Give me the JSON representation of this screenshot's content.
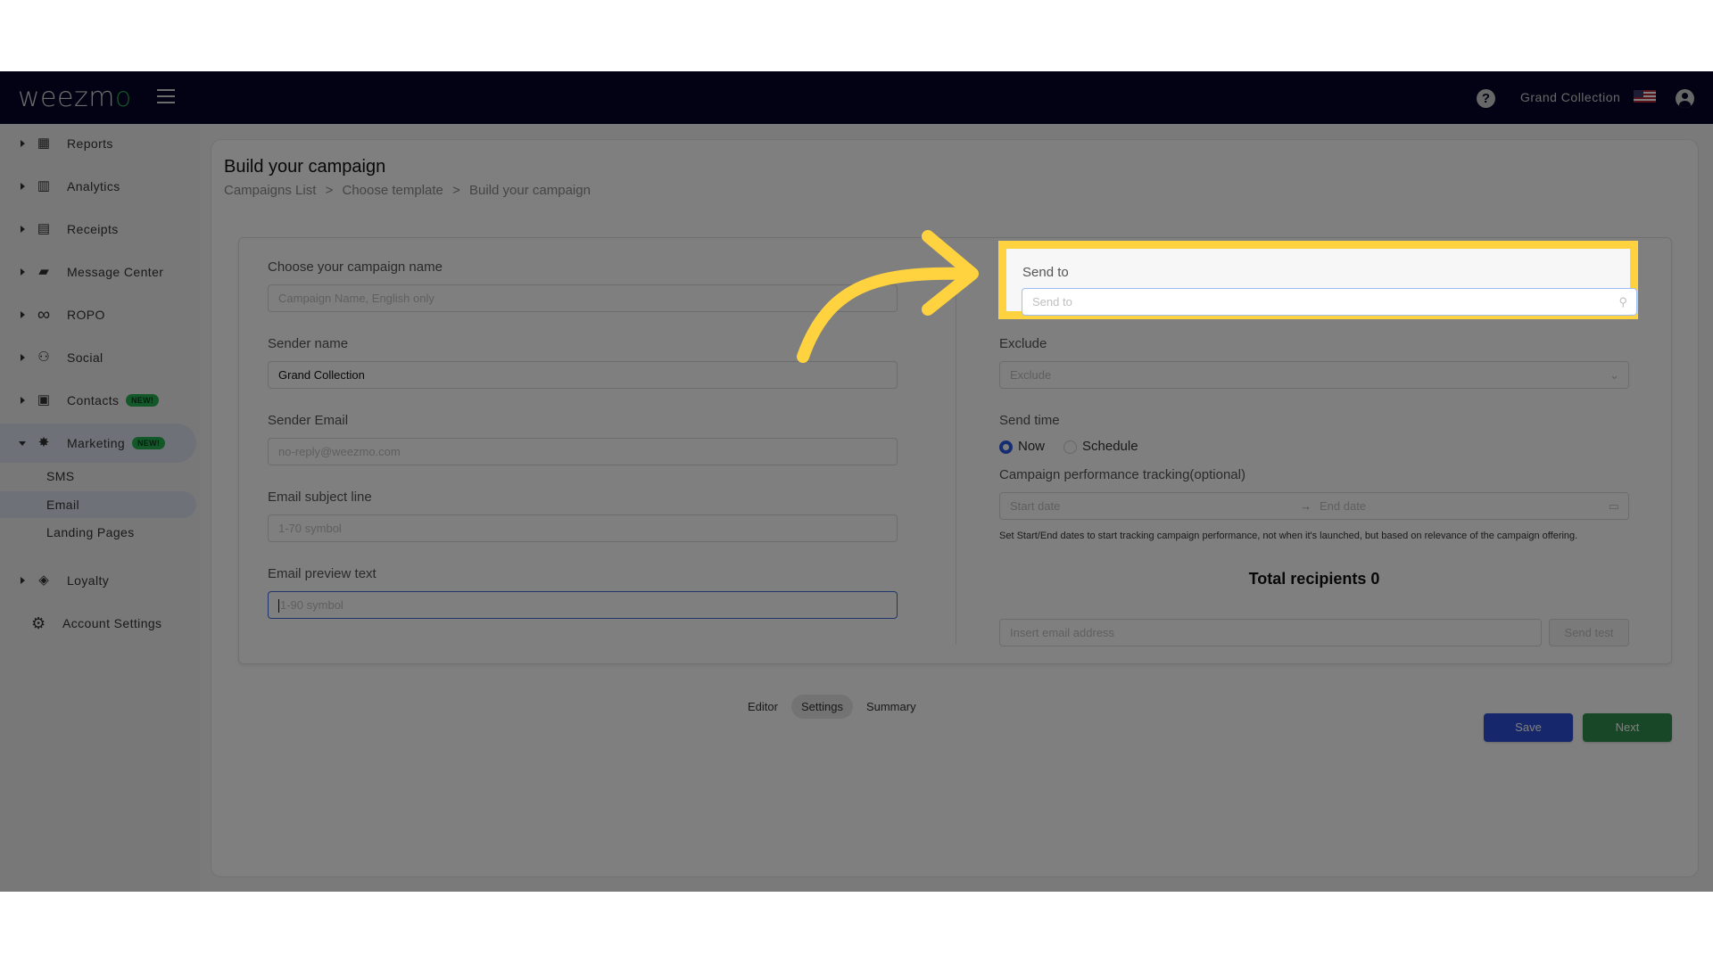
{
  "topbar": {
    "logo": "weezm",
    "logo_accent": "o",
    "store_name": "Grand Collection",
    "help_icon": "?",
    "flag": "us-flag-icon"
  },
  "sidebar": {
    "items": [
      {
        "label": "Reports",
        "icon": "dashboard-icon",
        "glyph": "▦"
      },
      {
        "label": "Analytics",
        "icon": "bar-chart-icon",
        "glyph": "▥"
      },
      {
        "label": "Receipts",
        "icon": "receipt-icon",
        "glyph": "▤"
      },
      {
        "label": "Message Center",
        "icon": "chat-icon",
        "glyph": "▰"
      },
      {
        "label": "ROPO",
        "icon": "infinity-icon",
        "glyph": "∞"
      },
      {
        "label": "Social",
        "icon": "group-icon",
        "glyph": "⚇"
      },
      {
        "label": "Contacts",
        "icon": "contacts-icon",
        "glyph": "▣",
        "badge": "NEW!"
      },
      {
        "label": "Marketing",
        "icon": "party-popper-icon",
        "glyph": "✸",
        "badge": "NEW!",
        "expanded": true
      },
      {
        "label": "Loyalty",
        "icon": "tag-icon",
        "glyph": "◈"
      },
      {
        "label": "Account Settings",
        "icon": "gear-icon",
        "glyph": "⚙"
      }
    ],
    "sub_items": [
      {
        "label": "SMS"
      },
      {
        "label": "Email",
        "active": true
      },
      {
        "label": "Landing Pages"
      }
    ]
  },
  "page": {
    "title": "Build your campaign",
    "breadcrumb": [
      "Campaigns List",
      ">",
      "Choose template",
      ">",
      "Build your campaign"
    ]
  },
  "form": {
    "campaign_name": {
      "label": "Choose your campaign name",
      "placeholder": "Campaign Name, English only",
      "value": ""
    },
    "sender_name": {
      "label": "Sender name",
      "value": "Grand Collection"
    },
    "sender_email": {
      "label": "Sender Email",
      "placeholder": "no-reply@weezmo.com"
    },
    "subject_line": {
      "label": "Email subject line",
      "placeholder": "1-70 symbol"
    },
    "preview_text": {
      "label": "Email preview text",
      "placeholder": "1-90 symbol"
    },
    "send_to": {
      "label": "Send to",
      "placeholder": "Send to"
    },
    "exclude": {
      "label": "Exclude",
      "placeholder": "Exclude"
    },
    "send_time": {
      "label": "Send time",
      "options": [
        "Now",
        "Schedule"
      ],
      "selected": "Now"
    },
    "tracking": {
      "label": "Campaign performance tracking(optional)",
      "start_placeholder": "Start date",
      "end_placeholder": "End date",
      "hint": "Set Start/End dates to start tracking campaign performance, not when it's launched, but based on relevance of the campaign offering."
    },
    "total_recipients": "Total recipients 0",
    "test_email": {
      "placeholder": "Insert email address",
      "button": "Send test"
    }
  },
  "tabs": [
    {
      "label": "Editor"
    },
    {
      "label": "Settings",
      "active": true
    },
    {
      "label": "Summary"
    }
  ],
  "actions": {
    "save": "Save",
    "next": "Next"
  },
  "colors": {
    "topbar": "#050529",
    "highlight": "#ffd23f",
    "save": "#2d4fd6",
    "next": "#2f8f4e",
    "badge": "#26b050"
  }
}
